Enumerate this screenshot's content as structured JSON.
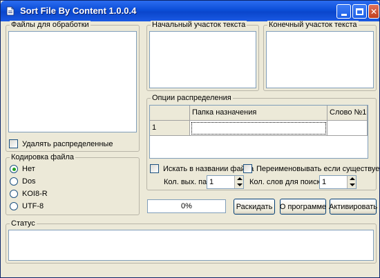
{
  "window": {
    "title": "Sort File By Content 1.0.0.4",
    "controls": {
      "minimize": "minimize-icon",
      "maximize": "maximize-icon",
      "close": "close-icon"
    }
  },
  "files_group": {
    "label": "Файлы для обработки",
    "delete_checkbox_label": "Удалять распределенные",
    "delete_checked": false
  },
  "start_text": {
    "label": "Начальный участок текста"
  },
  "end_text": {
    "label": "Конечный участок текста"
  },
  "encoding": {
    "label": "Кодировка файла",
    "options": [
      "Нет",
      "Dos",
      "KOI8-R",
      "UTF-8"
    ],
    "selected": "Нет"
  },
  "options": {
    "label": "Опции распределения",
    "grid": {
      "headers": [
        "",
        "Папка назначения",
        "Слово №1"
      ],
      "rows": [
        [
          "1",
          "",
          ""
        ]
      ]
    },
    "search_in_name_label": "Искать в названии файла",
    "rename_if_exists_label": "Переименовывать если существует",
    "out_folders_label": "Кол. вых. папок",
    "out_folders_value": "1",
    "search_words_label": "Кол. слов для поиска",
    "search_words_value": "1"
  },
  "progress": {
    "text": "0%",
    "value": 0
  },
  "buttons": {
    "distribute": "Раскидать",
    "about": "О программе",
    "activate": "Активировать"
  },
  "status": {
    "label": "Статус",
    "text": ""
  },
  "colors": {
    "title_bar": "#0c4ed8",
    "window_bg": "#ece9d8",
    "close_button": "#c2401e",
    "radio_selected": "#21a121"
  }
}
